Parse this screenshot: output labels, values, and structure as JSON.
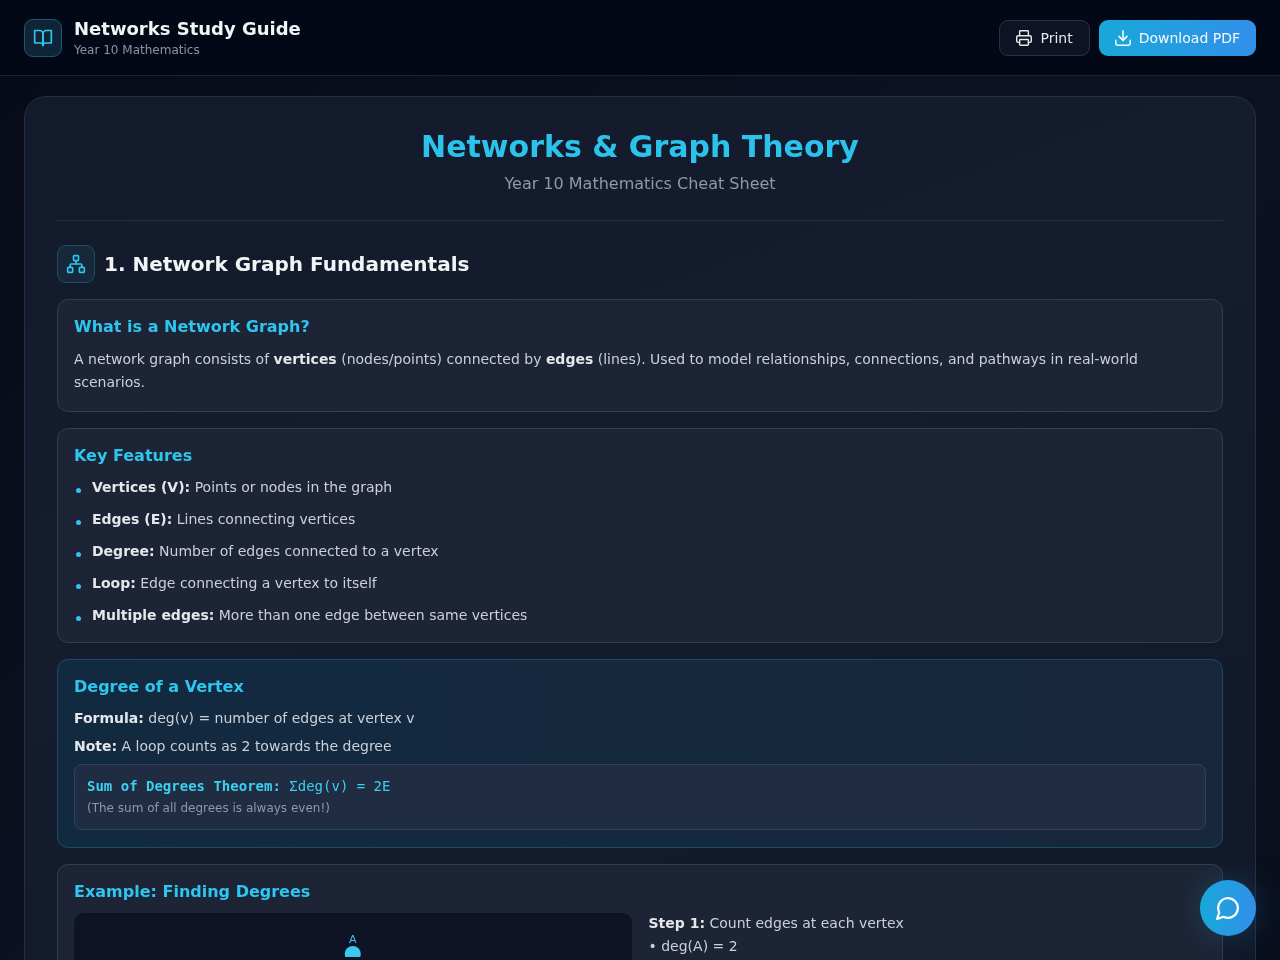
{
  "header": {
    "title": "Networks Study Guide",
    "subtitle": "Year 10 Mathematics",
    "buttons": [
      {
        "label": "Print",
        "kind": "secondary"
      },
      {
        "label": "Download PDF",
        "kind": "primary"
      }
    ]
  },
  "sheet": {
    "title": "Networks & Graph Theory",
    "subtitle": "Year 10 Mathematics Cheat Sheet"
  },
  "sections": [
    {
      "heading": "1. Network Graph Fundamentals",
      "cards": [
        {
          "kind": "text",
          "heading": "What is a Network Graph?",
          "text": "A network graph consists of **vertices** (nodes/points) connected by **edges** (lines). Used to model relationships, connections, and pathways in real-world scenarios."
        },
        {
          "kind": "list",
          "heading": "Key Features",
          "items": [
            "**Vertices (V):** Points or nodes in the graph",
            "**Edges (E):** Lines connecting vertices",
            "**Degree:** Number of edges connected to a vertex",
            "**Loop:** Edge connecting a vertex to itself",
            "**Multiple edges:** More than one edge between same vertices"
          ]
        },
        {
          "kind": "formula",
          "heading": "Degree of a Vertex",
          "lines": [
            "**Formula:** deg(v) = number of edges at vertex v",
            "**Note:** A loop counts as 2 towards the degree"
          ],
          "theorem": {
            "formula": "**Sum of Degrees Theorem:** Σdeg(v) = 2E",
            "note": "(The sum of all degrees is always even!)"
          }
        },
        {
          "kind": "example",
          "heading": "Example: Finding Degrees",
          "graph": {
            "nodes": [
              {
                "label": "A"
              }
            ]
          },
          "steps": [
            {
              "text": "**Step 1:** Count edges at each vertex",
              "results": [
                "• deg(A) = 2"
              ]
            }
          ]
        }
      ]
    }
  ]
}
